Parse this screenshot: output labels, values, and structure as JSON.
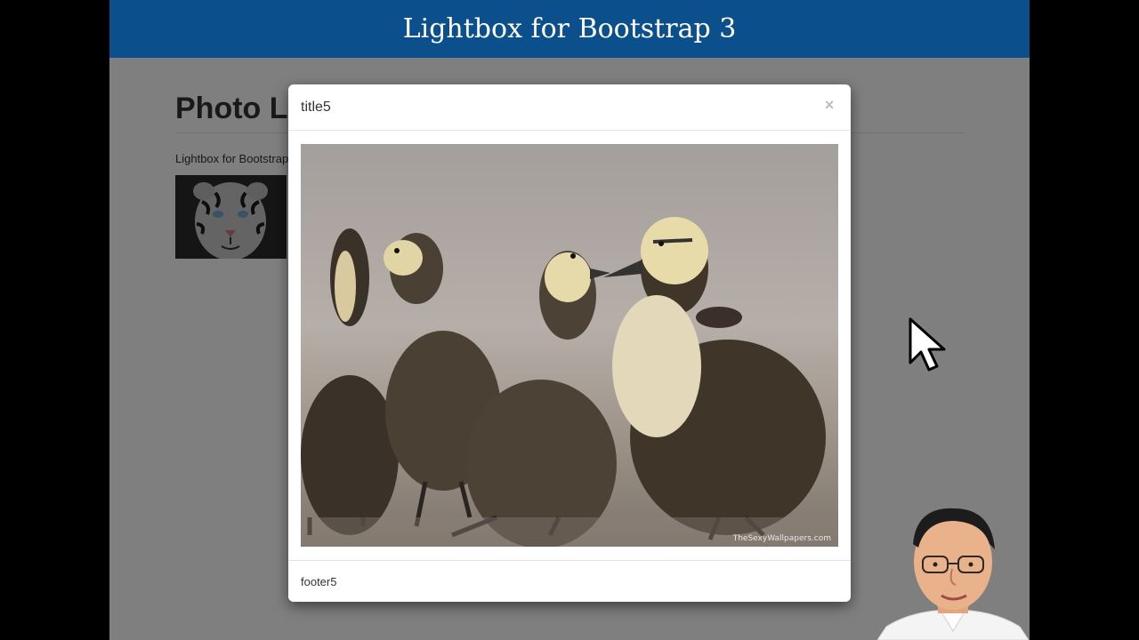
{
  "banner": {
    "title": "Lightbox for Bootstrap 3"
  },
  "page": {
    "heading": "Photo Li",
    "description": "Lightbox for Bootstrap"
  },
  "modal": {
    "title": "title5",
    "close_glyph": "×",
    "image_icon": "ducklings-photo",
    "watermark": "TheSexyWallpapers.com",
    "footer": "footer5"
  },
  "colors": {
    "banner": "#0b4f8c",
    "backdrop": "rgba(0,0,0,0.5)"
  }
}
